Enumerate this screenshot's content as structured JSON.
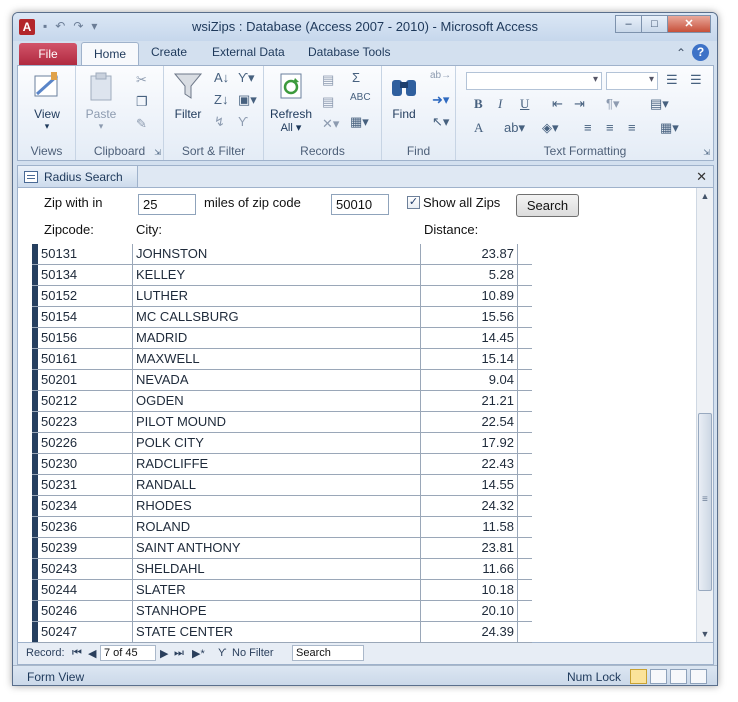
{
  "window": {
    "app_icon_letter": "A",
    "title": "wsiZips : Database (Access 2007 - 2010)  -  Microsoft Access",
    "minimize": "–",
    "maximize": "□",
    "close": "✕"
  },
  "ribbon_tabs": {
    "file": "File",
    "home": "Home",
    "create": "Create",
    "external_data": "External Data",
    "database_tools": "Database Tools"
  },
  "ribbon": {
    "views": {
      "view_label": "View",
      "group": "Views"
    },
    "clipboard": {
      "paste_label": "Paste",
      "group": "Clipboard"
    },
    "sort_filter": {
      "filter_label": "Filter",
      "group": "Sort & Filter"
    },
    "records": {
      "refresh_label": "Refresh",
      "refresh_sub": "All ▾",
      "group": "Records"
    },
    "find": {
      "find_label": "Find",
      "group": "Find"
    },
    "text_formatting": {
      "group": "Text Formatting",
      "bold": "B",
      "italic": "I",
      "underline": "U",
      "font_color": "A"
    }
  },
  "document": {
    "tab_label": "Radius Search",
    "close": "✕"
  },
  "form": {
    "zip_within_label": "Zip with in",
    "miles_value": "25",
    "miles_of_label": "miles of zip code",
    "zip_code_value": "50010",
    "show_all_checked": "✓",
    "show_all_label": "Show all Zips",
    "search_button": "Search",
    "col_zip": "Zipcode:",
    "col_city": "City:",
    "col_distance": "Distance:"
  },
  "rows": [
    {
      "zip": "50131",
      "city": "JOHNSTON",
      "distance": "23.87"
    },
    {
      "zip": "50134",
      "city": "KELLEY",
      "distance": "5.28"
    },
    {
      "zip": "50152",
      "city": "LUTHER",
      "distance": "10.89"
    },
    {
      "zip": "50154",
      "city": "MC CALLSBURG",
      "distance": "15.56"
    },
    {
      "zip": "50156",
      "city": "MADRID",
      "distance": "14.45"
    },
    {
      "zip": "50161",
      "city": "MAXWELL",
      "distance": "15.14"
    },
    {
      "zip": "50201",
      "city": "NEVADA",
      "distance": "9.04"
    },
    {
      "zip": "50212",
      "city": "OGDEN",
      "distance": "21.21"
    },
    {
      "zip": "50223",
      "city": "PILOT MOUND",
      "distance": "22.54"
    },
    {
      "zip": "50226",
      "city": "POLK CITY",
      "distance": "17.92"
    },
    {
      "zip": "50230",
      "city": "RADCLIFFE",
      "distance": "22.43"
    },
    {
      "zip": "50231",
      "city": "RANDALL",
      "distance": "14.55"
    },
    {
      "zip": "50234",
      "city": "RHODES",
      "distance": "24.32"
    },
    {
      "zip": "50236",
      "city": "ROLAND",
      "distance": "11.58"
    },
    {
      "zip": "50239",
      "city": "SAINT ANTHONY",
      "distance": "23.81"
    },
    {
      "zip": "50243",
      "city": "SHELDAHL",
      "distance": "11.66"
    },
    {
      "zip": "50244",
      "city": "SLATER",
      "distance": "10.18"
    },
    {
      "zip": "50246",
      "city": "STANHOPE",
      "distance": "20.10"
    },
    {
      "zip": "50247",
      "city": "STATE CENTER",
      "distance": "24.39"
    }
  ],
  "navigation": {
    "record_label": "Record:",
    "first": "⏮",
    "prev": "◀",
    "position": "7 of 45",
    "next": "▶",
    "last": "⏭",
    "new": "▶*",
    "filter_label": "No Filter",
    "search_placeholder": "Search"
  },
  "status": {
    "view_name": "Form View",
    "num_lock": "Num Lock"
  }
}
